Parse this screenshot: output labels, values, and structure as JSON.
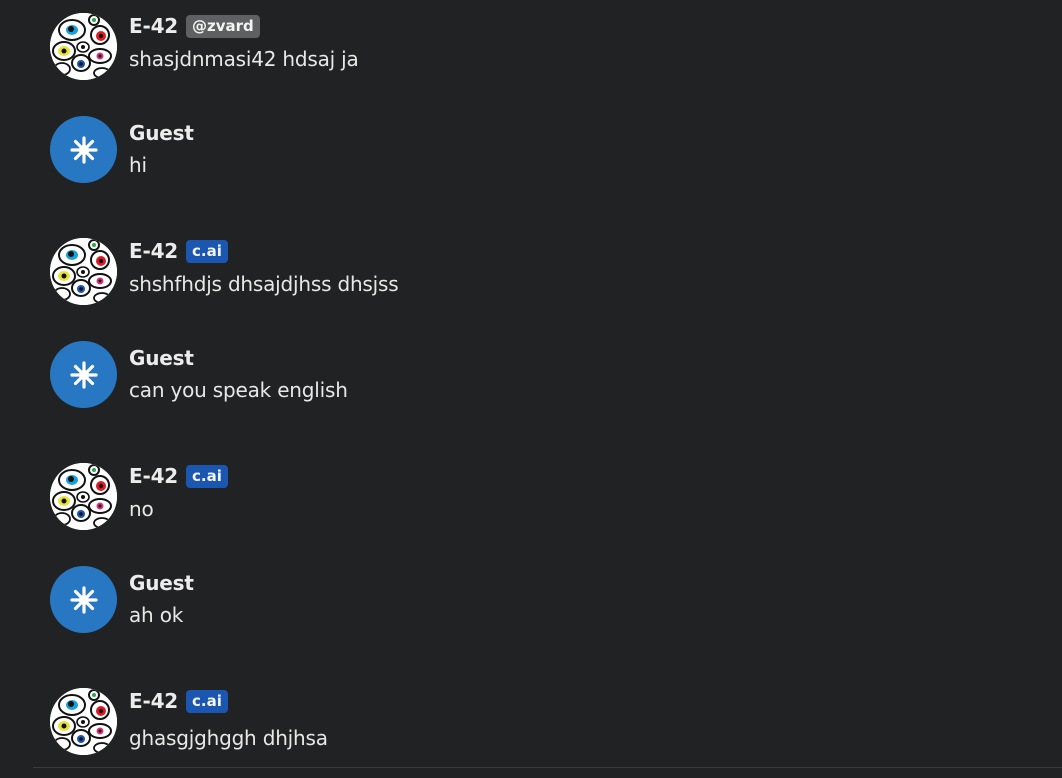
{
  "messages": [
    {
      "author": "E-42",
      "badge": "@zvard",
      "text": "shasjdnmasi42 hdsaj ja"
    },
    {
      "author": "Guest",
      "badge": "",
      "text": "hi"
    },
    {
      "author": "E-42",
      "badge": "c.ai",
      "text": "shshfhdjs dhsajdjhss dhsjss"
    },
    {
      "author": "Guest",
      "badge": "",
      "text": "can you speak english"
    },
    {
      "author": "E-42",
      "badge": "c.ai",
      "text": "no"
    },
    {
      "author": "Guest",
      "badge": "",
      "text": "ah ok"
    },
    {
      "author": "E-42",
      "badge": "c.ai",
      "text": "ghasgjghggh dhjhsa"
    }
  ],
  "icons": {
    "bot_avatar": "cells-avatar-icon",
    "guest_avatar": "asterisk-avatar-icon"
  },
  "colors": {
    "background": "#212223",
    "guest_avatar": "#2877c2",
    "cai_badge": "#1b57b0",
    "user_badge": "#5e6061"
  }
}
